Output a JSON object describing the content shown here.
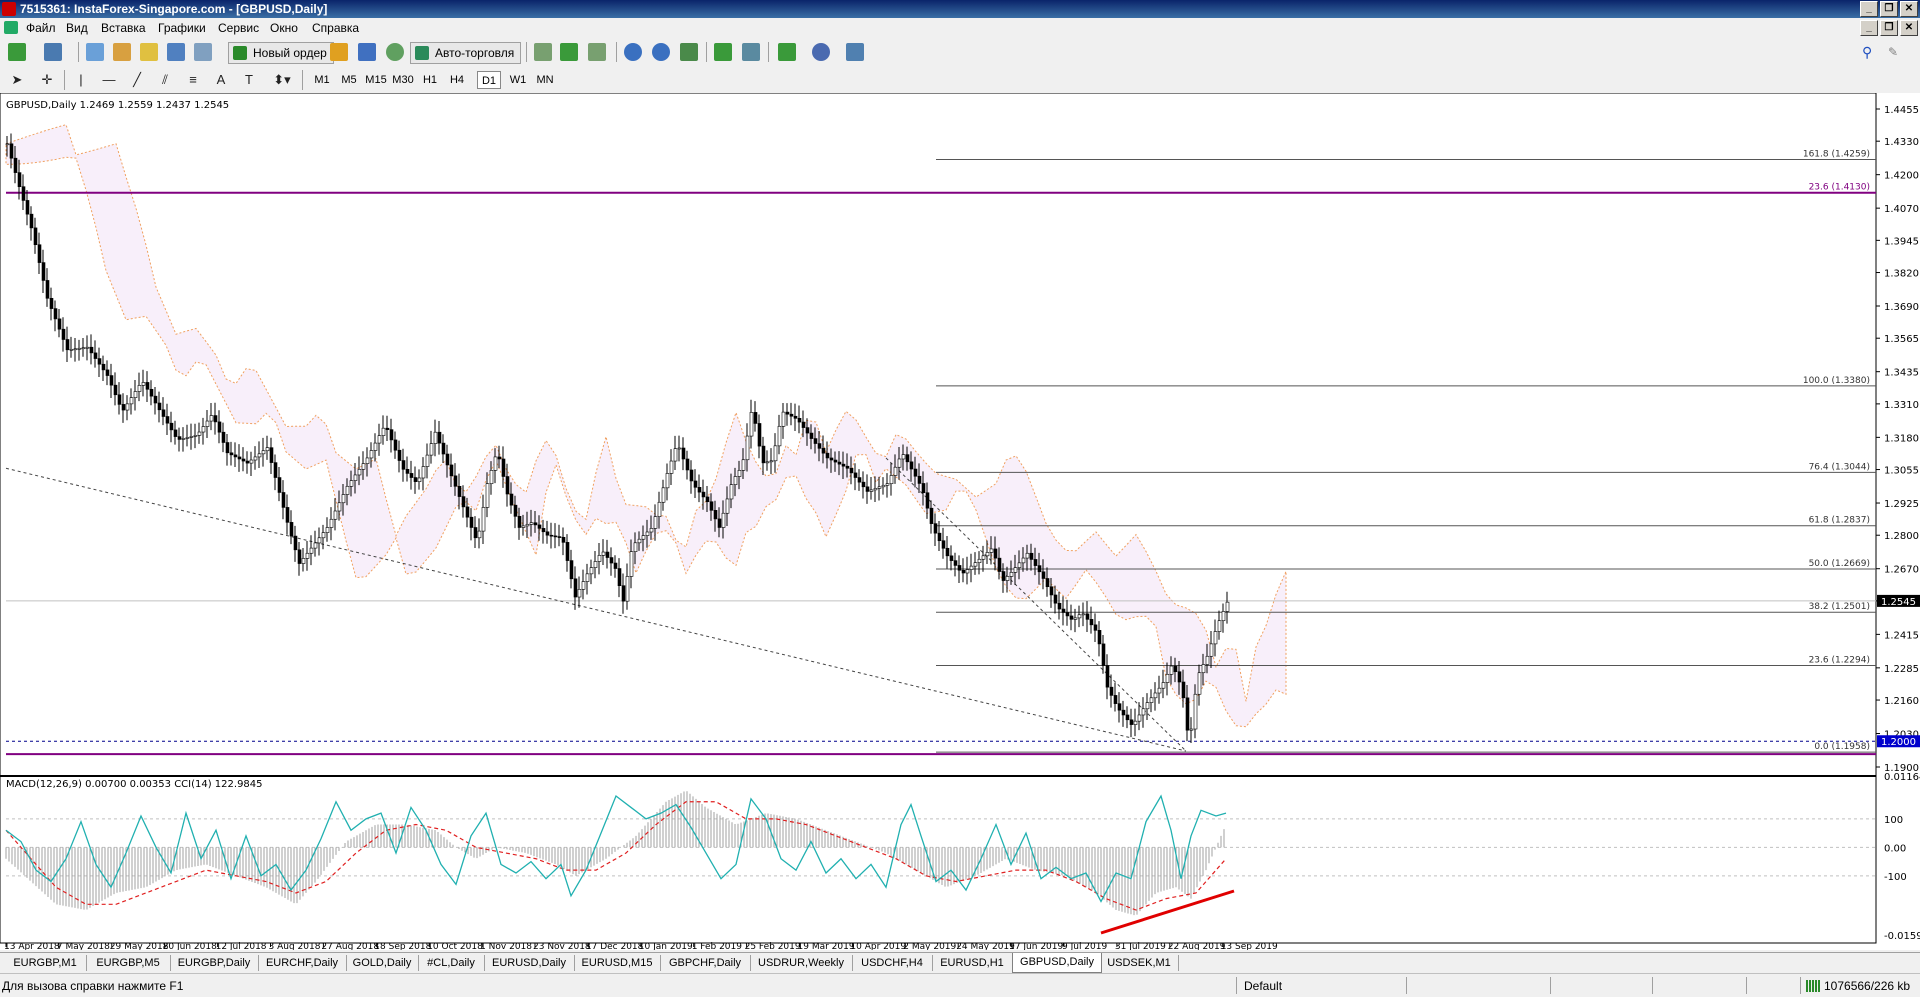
{
  "window": {
    "title": "7515361: InstaForex-Singapore.com - [GBPUSD,Daily]"
  },
  "menu": [
    "Файл",
    "Вид",
    "Вставка",
    "Графики",
    "Сервис",
    "Окно",
    "Справка"
  ],
  "toolbar": {
    "new_order": "Новый ордер",
    "auto_trading": "Авто-торговля"
  },
  "timeframes": [
    "M1",
    "M5",
    "M15",
    "M30",
    "H1",
    "H4",
    "D1",
    "W1",
    "MN"
  ],
  "active_timeframe": "D1",
  "chart": {
    "header": "GBPUSD,Daily  1.2469 1.2559 1.2437 1.2545",
    "current_price": "1.2545",
    "level_1_2000": "1.2000",
    "price_axis": [
      "1.4455",
      "1.4330",
      "1.4200",
      "1.4070",
      "1.3945",
      "1.3820",
      "1.3690",
      "1.3565",
      "1.3435",
      "1.3310",
      "1.3180",
      "1.3055",
      "1.2925",
      "1.2800",
      "1.2670",
      "1.2545",
      "1.2415",
      "1.2285",
      "1.2160",
      "1.2030",
      "1.1900"
    ],
    "date_axis": [
      "13 Apr 2018",
      "7 May 2018",
      "29 May 2018",
      "20 Jun 2018",
      "12 Jul 2018",
      "3 Aug 2018",
      "27 Aug 2018",
      "18 Sep 2018",
      "10 Oct 2018",
      "1 Nov 2018",
      "23 Nov 2018",
      "17 Dec 2018",
      "10 Jan 2019",
      "1 Feb 2019",
      "25 Feb 2019",
      "19 Mar 2019",
      "10 Apr 2019",
      "2 May 2019",
      "24 May 2019",
      "17 Jun 2019",
      "9 Jul 2019",
      "31 Jul 2019",
      "22 Aug 2019",
      "13 Sep 2019"
    ],
    "fib_levels": [
      {
        "label": "161.8 (1.4259)",
        "price": 1.4259
      },
      {
        "label": "23.6 (1.4130)",
        "price": 1.413
      },
      {
        "label": "100.0 (1.3380)",
        "price": 1.338
      },
      {
        "label": "76.4 (1.3044)",
        "price": 1.3044
      },
      {
        "label": "61.8 (1.2837)",
        "price": 1.2837
      },
      {
        "label": "50.0 (1.2669)",
        "price": 1.2669
      },
      {
        "label": "38.2 (1.2501)",
        "price": 1.2501
      },
      {
        "label": "23.6 (1.2294)",
        "price": 1.2294
      },
      {
        "label": "0.0 (1.1958)",
        "price": 1.1958
      }
    ],
    "price_path": [
      [
        0,
        1.432
      ],
      [
        10,
        1.418
      ],
      [
        25,
        1.398
      ],
      [
        40,
        1.372
      ],
      [
        60,
        1.352
      ],
      [
        80,
        1.353
      ],
      [
        100,
        1.342
      ],
      [
        115,
        1.328
      ],
      [
        135,
        1.34
      ],
      [
        150,
        1.33
      ],
      [
        170,
        1.317
      ],
      [
        190,
        1.319
      ],
      [
        205,
        1.327
      ],
      [
        220,
        1.312
      ],
      [
        240,
        1.308
      ],
      [
        260,
        1.314
      ],
      [
        280,
        1.285
      ],
      [
        292,
        1.269
      ],
      [
        300,
        1.273
      ],
      [
        320,
        1.283
      ],
      [
        340,
        1.299
      ],
      [
        360,
        1.31
      ],
      [
        378,
        1.323
      ],
      [
        395,
        1.306
      ],
      [
        410,
        1.3
      ],
      [
        428,
        1.32
      ],
      [
        445,
        1.302
      ],
      [
        460,
        1.287
      ],
      [
        470,
        1.277
      ],
      [
        480,
        1.3
      ],
      [
        490,
        1.313
      ],
      [
        500,
        1.296
      ],
      [
        512,
        1.283
      ],
      [
        525,
        1.285
      ],
      [
        540,
        1.28
      ],
      [
        555,
        1.279
      ],
      [
        568,
        1.256
      ],
      [
        580,
        1.265
      ],
      [
        595,
        1.274
      ],
      [
        610,
        1.266
      ],
      [
        615,
        1.252
      ],
      [
        625,
        1.276
      ],
      [
        645,
        1.283
      ],
      [
        660,
        1.304
      ],
      [
        670,
        1.316
      ],
      [
        685,
        1.3
      ],
      [
        700,
        1.293
      ],
      [
        712,
        1.283
      ],
      [
        725,
        1.301
      ],
      [
        735,
        1.307
      ],
      [
        745,
        1.33
      ],
      [
        755,
        1.308
      ],
      [
        765,
        1.309
      ],
      [
        775,
        1.328
      ],
      [
        790,
        1.325
      ],
      [
        805,
        1.317
      ],
      [
        820,
        1.31
      ],
      [
        840,
        1.306
      ],
      [
        860,
        1.297
      ],
      [
        880,
        1.3
      ],
      [
        895,
        1.312
      ],
      [
        905,
        1.305
      ],
      [
        915,
        1.298
      ],
      [
        925,
        1.283
      ],
      [
        940,
        1.272
      ],
      [
        955,
        1.265
      ],
      [
        970,
        1.27
      ],
      [
        985,
        1.275
      ],
      [
        995,
        1.262
      ],
      [
        1005,
        1.266
      ],
      [
        1020,
        1.273
      ],
      [
        1035,
        1.264
      ],
      [
        1050,
        1.252
      ],
      [
        1065,
        1.247
      ],
      [
        1075,
        1.25
      ],
      [
        1090,
        1.242
      ],
      [
        1100,
        1.221
      ],
      [
        1110,
        1.213
      ],
      [
        1125,
        1.206
      ],
      [
        1140,
        1.215
      ],
      [
        1155,
        1.222
      ],
      [
        1165,
        1.23
      ],
      [
        1175,
        1.22
      ],
      [
        1182,
        1.198
      ],
      [
        1190,
        1.225
      ],
      [
        1200,
        1.233
      ],
      [
        1210,
        1.245
      ],
      [
        1220,
        1.254
      ]
    ],
    "macd": {
      "label": "MACD(12,26,9) 0.00700 0.00353  CCI(14) 122.9845",
      "axis": [
        "0.01164",
        "100",
        "0.00",
        "-100",
        "-0.01591"
      ],
      "histogram": [
        [
          0,
          -0.002
        ],
        [
          25,
          -0.006
        ],
        [
          50,
          -0.01
        ],
        [
          80,
          -0.011
        ],
        [
          110,
          -0.008
        ],
        [
          140,
          -0.007
        ],
        [
          170,
          -0.004
        ],
        [
          200,
          -0.003
        ],
        [
          230,
          -0.005
        ],
        [
          260,
          -0.007
        ],
        [
          290,
          -0.01
        ],
        [
          310,
          -0.006
        ],
        [
          340,
          0.001
        ],
        [
          370,
          0.004
        ],
        [
          400,
          0.004
        ],
        [
          430,
          0.003
        ],
        [
          450,
          0.0
        ],
        [
          470,
          -0.002
        ],
        [
          490,
          0.0
        ],
        [
          520,
          -0.001
        ],
        [
          550,
          -0.003
        ],
        [
          570,
          -0.005
        ],
        [
          600,
          -0.002
        ],
        [
          630,
          0.002
        ],
        [
          660,
          0.008
        ],
        [
          680,
          0.01
        ],
        [
          700,
          0.007
        ],
        [
          730,
          0.004
        ],
        [
          760,
          0.006
        ],
        [
          790,
          0.005
        ],
        [
          820,
          0.003
        ],
        [
          850,
          0.001
        ],
        [
          880,
          -0.001
        ],
        [
          910,
          -0.004
        ],
        [
          940,
          -0.007
        ],
        [
          970,
          -0.005
        ],
        [
          1000,
          -0.002
        ],
        [
          1030,
          -0.004
        ],
        [
          1060,
          -0.005
        ],
        [
          1090,
          -0.008
        ],
        [
          1110,
          -0.011
        ],
        [
          1130,
          -0.012
        ],
        [
          1150,
          -0.008
        ],
        [
          1170,
          -0.007
        ],
        [
          1185,
          -0.009
        ],
        [
          1200,
          -0.004
        ],
        [
          1220,
          0.004
        ]
      ],
      "signal": [
        [
          0,
          0.003
        ],
        [
          25,
          -0.002
        ],
        [
          50,
          -0.007
        ],
        [
          80,
          -0.01
        ],
        [
          110,
          -0.01
        ],
        [
          140,
          -0.008
        ],
        [
          170,
          -0.006
        ],
        [
          200,
          -0.004
        ],
        [
          230,
          -0.005
        ],
        [
          260,
          -0.006
        ],
        [
          290,
          -0.008
        ],
        [
          320,
          -0.006
        ],
        [
          350,
          -0.001
        ],
        [
          380,
          0.003
        ],
        [
          410,
          0.004
        ],
        [
          440,
          0.003
        ],
        [
          470,
          0.0
        ],
        [
          500,
          -0.001
        ],
        [
          530,
          -0.002
        ],
        [
          560,
          -0.004
        ],
        [
          590,
          -0.004
        ],
        [
          620,
          -0.001
        ],
        [
          650,
          0.004
        ],
        [
          680,
          0.008
        ],
        [
          710,
          0.008
        ],
        [
          740,
          0.005
        ],
        [
          770,
          0.005
        ],
        [
          800,
          0.004
        ],
        [
          830,
          0.002
        ],
        [
          860,
          0.0
        ],
        [
          890,
          -0.002
        ],
        [
          920,
          -0.005
        ],
        [
          950,
          -0.006
        ],
        [
          980,
          -0.005
        ],
        [
          1010,
          -0.004
        ],
        [
          1040,
          -0.004
        ],
        [
          1070,
          -0.006
        ],
        [
          1100,
          -0.009
        ],
        [
          1130,
          -0.011
        ],
        [
          1160,
          -0.009
        ],
        [
          1190,
          -0.008
        ],
        [
          1210,
          -0.004
        ],
        [
          1220,
          -0.002
        ]
      ],
      "cci": [
        [
          0,
          60
        ],
        [
          15,
          20
        ],
        [
          30,
          -80
        ],
        [
          45,
          -120
        ],
        [
          60,
          -40
        ],
        [
          75,
          90
        ],
        [
          90,
          -60
        ],
        [
          105,
          -140
        ],
        [
          120,
          -20
        ],
        [
          135,
          110
        ],
        [
          150,
          0
        ],
        [
          165,
          -90
        ],
        [
          180,
          120
        ],
        [
          195,
          -40
        ],
        [
          210,
          60
        ],
        [
          225,
          -110
        ],
        [
          240,
          40
        ],
        [
          255,
          -100
        ],
        [
          270,
          -60
        ],
        [
          285,
          -150
        ],
        [
          300,
          -80
        ],
        [
          315,
          30
        ],
        [
          330,
          160
        ],
        [
          345,
          60
        ],
        [
          360,
          100
        ],
        [
          375,
          120
        ],
        [
          390,
          -20
        ],
        [
          405,
          140
        ],
        [
          420,
          60
        ],
        [
          435,
          -60
        ],
        [
          450,
          -130
        ],
        [
          465,
          40
        ],
        [
          480,
          120
        ],
        [
          495,
          -60
        ],
        [
          510,
          -90
        ],
        [
          525,
          -50
        ],
        [
          540,
          -110
        ],
        [
          555,
          -60
        ],
        [
          565,
          -170
        ],
        [
          580,
          -80
        ],
        [
          595,
          50
        ],
        [
          610,
          180
        ],
        [
          625,
          140
        ],
        [
          640,
          100
        ],
        [
          655,
          120
        ],
        [
          670,
          150
        ],
        [
          685,
          70
        ],
        [
          700,
          -20
        ],
        [
          715,
          -110
        ],
        [
          730,
          -60
        ],
        [
          745,
          170
        ],
        [
          760,
          100
        ],
        [
          775,
          -40
        ],
        [
          790,
          -80
        ],
        [
          805,
          20
        ],
        [
          820,
          -90
        ],
        [
          835,
          -40
        ],
        [
          850,
          -110
        ],
        [
          865,
          -60
        ],
        [
          880,
          -140
        ],
        [
          895,
          80
        ],
        [
          905,
          150
        ],
        [
          915,
          40
        ],
        [
          930,
          -120
        ],
        [
          945,
          -80
        ],
        [
          960,
          -150
        ],
        [
          975,
          -40
        ],
        [
          990,
          80
        ],
        [
          1005,
          -60
        ],
        [
          1020,
          50
        ],
        [
          1035,
          -110
        ],
        [
          1050,
          -70
        ],
        [
          1065,
          -110
        ],
        [
          1080,
          -90
        ],
        [
          1095,
          -190
        ],
        [
          1110,
          -90
        ],
        [
          1125,
          -110
        ],
        [
          1140,
          90
        ],
        [
          1155,
          180
        ],
        [
          1165,
          60
        ],
        [
          1175,
          -110
        ],
        [
          1185,
          40
        ],
        [
          1195,
          130
        ],
        [
          1210,
          110
        ],
        [
          1220,
          120
        ]
      ]
    }
  },
  "tabs": [
    "EURGBP,M1",
    "EURGBP,M5",
    "EURGBP,Daily",
    "EURCHF,Daily",
    "GOLD,Daily",
    "#CL,Daily",
    "EURUSD,Daily",
    "EURUSD,M15",
    "GBPCHF,Daily",
    "USDRUR,Weekly",
    "USDCHF,H4",
    "EURUSD,H1",
    "GBPUSD,Daily",
    "USDSEK,M1"
  ],
  "active_tab": "GBPUSD,Daily",
  "status": {
    "help": "Для вызова справки нажмите F1",
    "profile": "Default",
    "traffic": "1076566/226 kb"
  }
}
